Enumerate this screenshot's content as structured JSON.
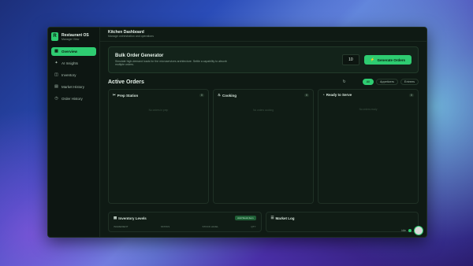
{
  "app": {
    "name": "Restaurant OS",
    "subtitle": "Manager View"
  },
  "sidebar": {
    "items": [
      {
        "label": "Overview",
        "icon": "grid-icon",
        "active": true
      },
      {
        "label": "AI Insights",
        "icon": "sparkle-icon"
      },
      {
        "label": "Inventory",
        "icon": "box-icon"
      },
      {
        "label": "Market History",
        "icon": "chart-icon"
      },
      {
        "label": "Order History",
        "icon": "clock-icon"
      }
    ]
  },
  "header": {
    "title": "Kitchen Dashboard",
    "subtitle": "Manage orchestration and operations"
  },
  "bulk": {
    "title": "Bulk Order Generator",
    "description": "Simulate high-demand loads for the microservices architecture. Settle a capability to absorb multiple orders.",
    "quantity": "10",
    "button": "Generate Orders"
  },
  "orders": {
    "title": "Active Orders",
    "filters": [
      "All",
      "Appetizers",
      "Entrees"
    ],
    "columns": [
      {
        "title": "Prep Station",
        "count": "0",
        "empty": "No orders in prep"
      },
      {
        "title": "Cooking",
        "count": "0",
        "empty": "No orders cooking"
      },
      {
        "title": "Ready to Serve",
        "count": "0",
        "empty": "No orders ready"
      }
    ]
  },
  "inventory": {
    "title": "Inventory Levels",
    "add": "Add Stock Item",
    "cols": [
      "INGREDIENT",
      "STATUS",
      "STOCK LEVEL",
      "QTY"
    ]
  },
  "market": {
    "title": "Market Log"
  },
  "status": {
    "label": "Idle"
  }
}
